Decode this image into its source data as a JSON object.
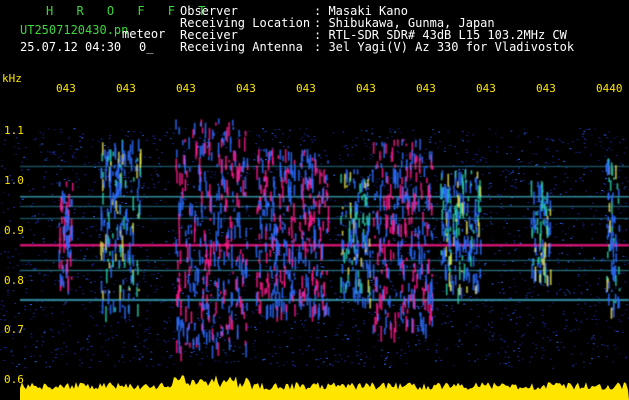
{
  "header": {
    "app_title": "H R O F F T",
    "file_name": "UT2507120430.pn",
    "mode_label": "meteor",
    "date_time": "25.07.12 04:30",
    "counter": "0_",
    "info_rows": [
      {
        "label": "Observer",
        "value": ": Masaki Kano"
      },
      {
        "label": "Receiving Location",
        "value": ": Shibukawa, Gunma, Japan"
      },
      {
        "label": "Receiver",
        "value": ": RTL-SDR SDR# 43dB L15 103.2MHz CW"
      },
      {
        "label": "Receiving Antenna",
        "value": ": 3el Yagi(V) Az 330 for Vladivostok"
      }
    ]
  },
  "axis": {
    "unit": "kHz",
    "y_ticks": [
      "1.1",
      "1.0",
      "0.9",
      "0.8",
      "0.7",
      "0.6"
    ],
    "time_ticks": [
      "043",
      "043",
      "043",
      "043",
      "043",
      "043",
      "043",
      "043",
      "043",
      "0440"
    ]
  },
  "colors": {
    "background": "#000000",
    "text_green": "#3bd63b",
    "text_white": "#ffffff",
    "axis_yellow": "#ffe600",
    "signal_pink": "#ff1a8c",
    "noise_blue": "#1a2aa8"
  }
}
